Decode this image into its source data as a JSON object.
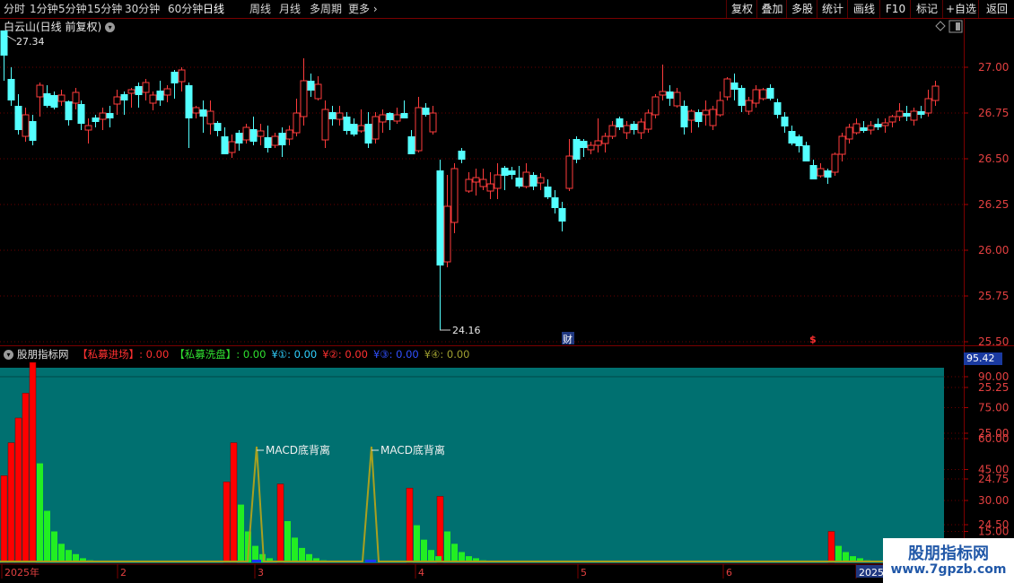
{
  "toolbar": {
    "periods": [
      "分时",
      "1分钟",
      "5分钟",
      "15分钟",
      "30分钟",
      "60分钟",
      "日线",
      "周线",
      "月线",
      "多周期",
      "更多"
    ],
    "active_period": "日线",
    "right_buttons": [
      "复权",
      "叠加",
      "多股",
      "统计",
      "画线",
      "F10",
      "标记",
      "+自选",
      "返回"
    ]
  },
  "main_chart": {
    "title": "白云山(日线 前复权)",
    "high_label": "27.34",
    "low_label": "24.16",
    "y_ticks": [
      "27.00",
      "26.75",
      "26.50",
      "26.25",
      "26.00",
      "25.75",
      "25.50",
      "25.25",
      "25.00",
      "24.75",
      "24.50"
    ],
    "markers": {
      "cai": "财",
      "dollar": "$"
    }
  },
  "indicator": {
    "name": "股朋指标网",
    "params": [
      {
        "label": "【私募进场】: 0.00",
        "color": "#ff3030"
      },
      {
        "label": "【私募洗盘】: 0.00",
        "color": "#30e030"
      },
      {
        "label": "¥①: 0.00",
        "color": "#30d0ff"
      },
      {
        "label": "¥②: 0.00",
        "color": "#ff3030"
      },
      {
        "label": "¥③: 0.00",
        "color": "#3050ff"
      },
      {
        "label": "¥④: 0.00",
        "color": "#a0a030"
      }
    ],
    "current_value": "95.42",
    "y_ticks": [
      "90.00",
      "75.00",
      "60.00",
      "45.00",
      "30.00",
      "15.00"
    ],
    "annotations": [
      "MACD底背离",
      "MACD底背离"
    ]
  },
  "time_axis": {
    "labels": [
      "2025年",
      "2",
      "3",
      "4",
      "5",
      "6",
      "2025"
    ]
  },
  "watermark": {
    "line1": "股朋指标网",
    "line2": "www.7gpzb.com"
  },
  "colors": {
    "up": "#ff3c3c",
    "down": "#54ffff",
    "panel": "#007070",
    "bar_red": "#ff0000",
    "bar_green": "#22ee22",
    "olive": "#a8a020"
  }
}
